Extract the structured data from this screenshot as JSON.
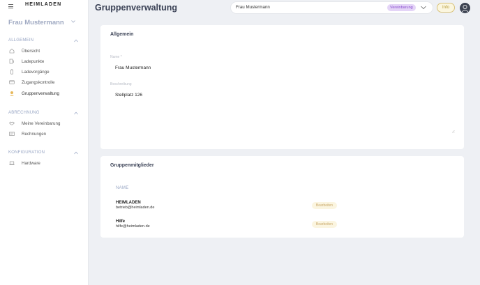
{
  "brand": {
    "logo_text": "HEIMLADEN"
  },
  "sidebar": {
    "user_name": "Frau Mustermann",
    "sections": [
      {
        "title": "ALLGEMEIN",
        "items": [
          {
            "label": "Übersicht",
            "icon": "home-icon"
          },
          {
            "label": "Ladepunkte",
            "icon": "charging-station-icon"
          },
          {
            "label": "Ladevorgänge",
            "icon": "battery-icon"
          },
          {
            "label": "Zugangskontrolle",
            "icon": "card-icon"
          },
          {
            "label": "Gruppenverwaltung",
            "icon": "group-icon",
            "active": true
          }
        ]
      },
      {
        "title": "ABRECHNUNG",
        "items": [
          {
            "label": "Meine Vereinbarung",
            "icon": "handshake-icon"
          },
          {
            "label": "Rechnungen",
            "icon": "invoice-icon"
          }
        ]
      },
      {
        "title": "KONFIGURATION",
        "items": [
          {
            "label": "Hardware",
            "icon": "laptop-icon"
          }
        ]
      }
    ]
  },
  "header": {
    "title": "Gruppenverwaltung",
    "search_value": "Frau Mustermann",
    "search_badge": "Vereinbarung",
    "info_label": "Info"
  },
  "general": {
    "title": "Allgemein",
    "name_label": "Name *",
    "name_value": "Frau Mustermann",
    "desc_label": "Beschreibung",
    "desc_value": "Stellplatz 126"
  },
  "members": {
    "title": "Gruppenmitglieder",
    "column_name": "NAME",
    "rows": [
      {
        "name": "HEIMLADEN",
        "email": "betrieb@heimladen.de",
        "action": "Bearbeiten"
      },
      {
        "name": "Hilfe",
        "email": "hilfe@heimladen.de",
        "action": "Bearbeiten"
      }
    ]
  },
  "colors": {
    "accent_purple": "#8a4fcf",
    "accent_gold": "#b69a37",
    "active_icon": "#e7b85a"
  }
}
